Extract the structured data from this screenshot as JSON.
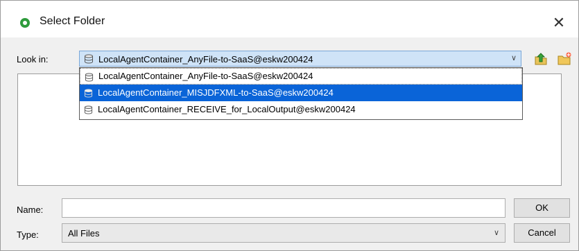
{
  "window": {
    "title": "Select Folder",
    "close_glyph": "✕"
  },
  "look_in": {
    "label": "Look in:",
    "selected": "LocalAgentContainer_AnyFile-to-SaaS@eskw200424",
    "options": [
      "LocalAgentContainer_AnyFile-to-SaaS@eskw200424",
      "LocalAgentContainer_MISJDFXML-to-SaaS@eskw200424",
      "LocalAgentContainer_RECEIVE_for_LocalOutput@eskw200424"
    ],
    "highlighted_index": 1,
    "option_icon": "database-icon"
  },
  "toolbar": {
    "up_icon": "up-folder-icon",
    "new_icon": "new-folder-icon"
  },
  "name_field": {
    "label": "Name:",
    "value": ""
  },
  "type_field": {
    "label": "Type:",
    "value": "All Files"
  },
  "buttons": {
    "ok": "OK",
    "cancel": "Cancel"
  },
  "colors": {
    "selection": "#0a64d8",
    "combo_bg": "#cfe3f7",
    "accent_green": "#2e9b3c"
  }
}
